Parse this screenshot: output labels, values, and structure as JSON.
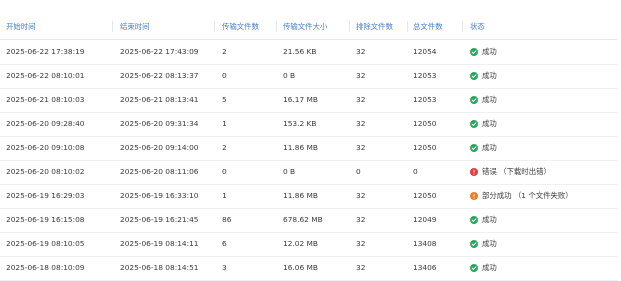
{
  "colors": {
    "header_text": "#4a7fc9",
    "success": "#2aa65a",
    "error": "#e23b3b",
    "partial": "#f07c1e"
  },
  "table": {
    "columns": [
      "开始时间",
      "结束时间",
      "传输文件数",
      "传输文件大小",
      "排除文件数",
      "总文件数",
      "状态"
    ],
    "rows": [
      {
        "start": "2025-06-22 17:38:19",
        "end": "2025-06-22 17:43:09",
        "files": "2",
        "size": "21.56 KB",
        "excluded": "32",
        "total": "12054",
        "status": "成功",
        "status_type": "success",
        "status_icon": "check-circle-icon"
      },
      {
        "start": "2025-06-22 08:10:01",
        "end": "2025-06-22 08:13:37",
        "files": "0",
        "size": "0 B",
        "excluded": "32",
        "total": "12053",
        "status": "成功",
        "status_type": "success",
        "status_icon": "check-circle-icon"
      },
      {
        "start": "2025-06-21 08:10:03",
        "end": "2025-06-21 08:13:41",
        "files": "5",
        "size": "16.17 MB",
        "excluded": "32",
        "total": "12053",
        "status": "成功",
        "status_type": "success",
        "status_icon": "check-circle-icon"
      },
      {
        "start": "2025-06-20 09:28:40",
        "end": "2025-06-20 09:31:34",
        "files": "1",
        "size": "153.2 KB",
        "excluded": "32",
        "total": "12050",
        "status": "成功",
        "status_type": "success",
        "status_icon": "check-circle-icon"
      },
      {
        "start": "2025-06-20 09:10:08",
        "end": "2025-06-20 09:14:00",
        "files": "2",
        "size": "11.86 MB",
        "excluded": "32",
        "total": "12050",
        "status": "成功",
        "status_type": "success",
        "status_icon": "check-circle-icon"
      },
      {
        "start": "2025-06-20 08:10:02",
        "end": "2025-06-20 08:11:06",
        "files": "0",
        "size": "0 B",
        "excluded": "0",
        "total": "0",
        "status": "错误 （下载时出错）",
        "status_type": "error",
        "status_icon": "error-circle-icon"
      },
      {
        "start": "2025-06-19 16:29:03",
        "end": "2025-06-19 16:33:10",
        "files": "1",
        "size": "11.86 MB",
        "excluded": "32",
        "total": "12050",
        "status": "部分成功 （1 个文件失败）",
        "status_type": "partial",
        "status_icon": "warning-circle-icon"
      },
      {
        "start": "2025-06-19 16:15:08",
        "end": "2025-06-19 16:21:45",
        "files": "86",
        "size": "678.62 MB",
        "excluded": "32",
        "total": "12049",
        "status": "成功",
        "status_type": "success",
        "status_icon": "check-circle-icon"
      },
      {
        "start": "2025-06-19 08:10:05",
        "end": "2025-06-19 08:14:11",
        "files": "6",
        "size": "12.02 MB",
        "excluded": "32",
        "total": "13408",
        "status": "成功",
        "status_type": "success",
        "status_icon": "check-circle-icon"
      },
      {
        "start": "2025-06-18 08:10:09",
        "end": "2025-06-18 08:14:51",
        "files": "3",
        "size": "16.06 MB",
        "excluded": "32",
        "total": "13406",
        "status": "成功",
        "status_type": "success",
        "status_icon": "check-circle-icon"
      }
    ]
  }
}
